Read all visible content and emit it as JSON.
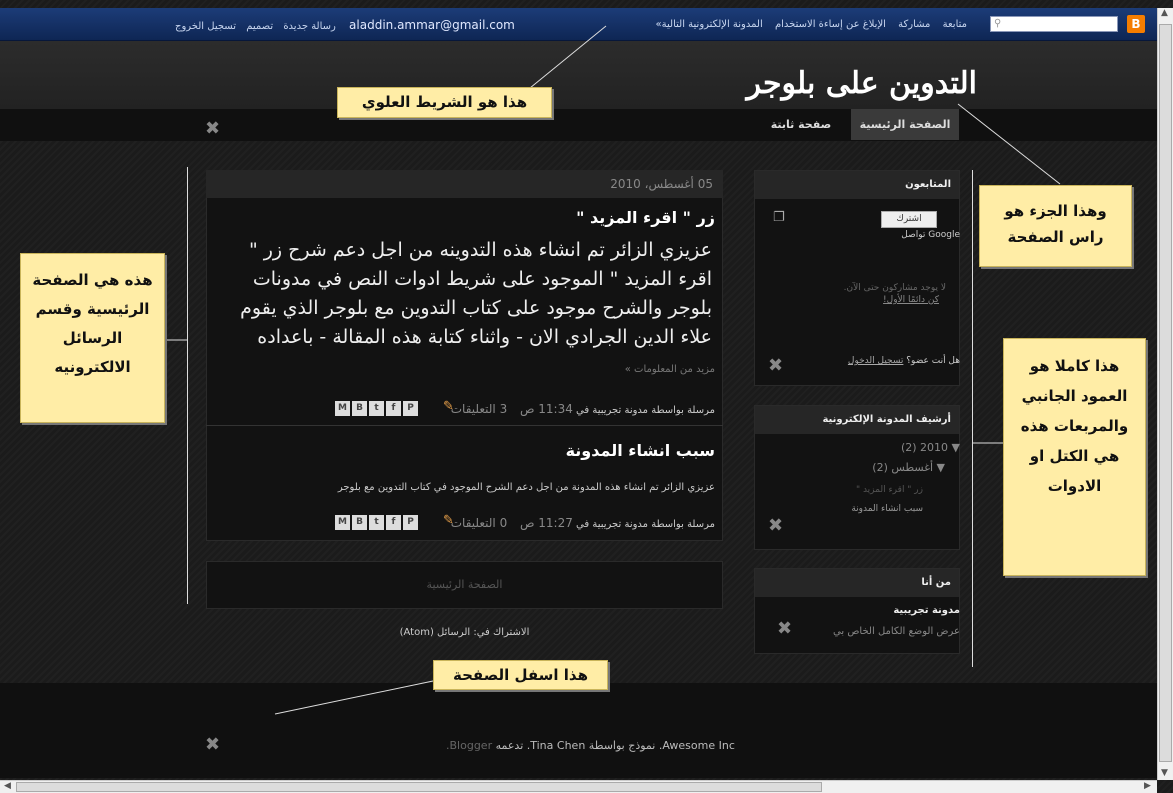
{
  "navbar": {
    "logo": "B",
    "right_links": [
      "متابعة",
      "مشاركة",
      "الإبلاغ عن إساءة الاستخدام",
      "المدونة الإلكترونية التالية»"
    ],
    "left_links": {
      "email": "aladdin.ammar@gmail.com",
      "new_post": "رسالة جديدة",
      "design": "تصميم",
      "sign_out": "تسجيل الخروج"
    }
  },
  "header": {
    "title": "التدوين على بلوجر"
  },
  "tabs": [
    {
      "label": "الصفحة الرئيسية"
    },
    {
      "label": "صفحة ثابتة"
    }
  ],
  "posts": {
    "date": "05 أغسطس، 2010",
    "post1": {
      "title": "زر \" اقرء المزيد \"",
      "body": "عزيزي الزائر تم انشاء هذه التدوينه من اجل دعم شرح زر \" اقرء المزيد \" الموجود على شريط ادوات النص في مدونات بلوجر والشرح موجود على كتاب التدوين مع بلوجر الذي يقوم علاء الدين الجرادي الان - واثناء كتابة هذه المقالة - باعداده",
      "more": "مزيد من المعلومات »",
      "posted_by": "مرسلة بواسطة مدونة تجريبية في",
      "time": "11:34 ص",
      "comments": "3 التعليقات"
    },
    "post2": {
      "title": "سبب انشاء المدونة",
      "body": "عزيزي الزائر تم انشاء هذه المدونة من اجل دعم الشرح الموجود في كتاب التدوين مع بلوجر",
      "posted_by": "مرسلة بواسطة مدونة تجريبية في",
      "time": "11:27 ص",
      "comments": "0 التعليقات"
    },
    "share_buttons": [
      "M",
      "B",
      "t",
      "f",
      "P"
    ],
    "pager": "الصفحة الرئيسية",
    "subscribe": "الاشتراك في: الرسائل (Atom)"
  },
  "sidebar": {
    "followers": {
      "title": "المتابعون",
      "follow_button": "اشترك",
      "google_connect": "Google تواصل",
      "no_followers": "لا يوجد مشاركون حتى الآن.",
      "be_first": "كن دائمًا الأول!",
      "member_prompt": "هل أنت عضو؟",
      "sign_in": "تسجيل الدخول"
    },
    "archive": {
      "title": "أرشيف المدونة الإلكترونية",
      "year": "2010 (2)",
      "month": "أغسطس (2)",
      "post1": "زر \" اقرء المزيد \"",
      "post2": "سبب انشاء المدونة"
    },
    "about": {
      "title": "من أنا",
      "name": "مدونة تجريبية",
      "profile_link": "عرض الوضع الكامل الخاص بي"
    }
  },
  "footer": {
    "credit_prefix": "Awesome Inc. نموذج بواسطة",
    "credit_author": "Tina Chen",
    "credit_powered": ". تدعمه",
    "credit_link": "Blogger."
  },
  "annotations": {
    "top_bar": "هذا هو الشريط العلوي",
    "header": "وهذا الجزء هو راس الصفحة",
    "main": "هذه هي الصفحة الرئيسية وقسم الرسائل الالكترونيه",
    "sidebar": "هذا كاملا هو العمود الجانبي والمربعات هذه هي الكتل او الادوات",
    "footer": "هذا اسفل الصفحة"
  }
}
